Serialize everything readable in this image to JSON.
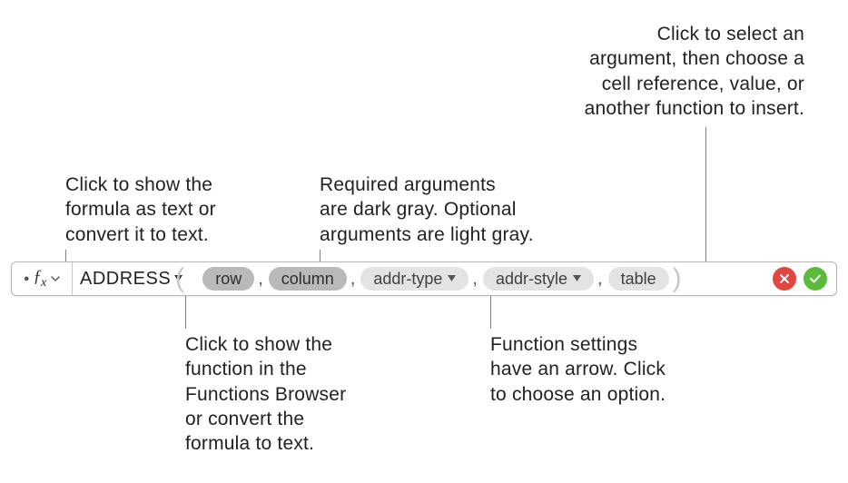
{
  "callouts": {
    "fx": "Click to show the\nformula as text or\nconvert it to text.",
    "required": "Required arguments\nare dark gray. Optional\narguments are light gray.",
    "selectArg": "Click to select an\nargument, then choose a\ncell reference, value, or\nanother function to insert.",
    "functionName": "Click to show the\nfunction in the\nFunctions Browser\nor convert the\nformula to text.",
    "settings": "Function settings\nhave an arrow. Click\nto choose an option."
  },
  "bar": {
    "fxLabel": "fx",
    "functionName": "ADDRESS",
    "args": [
      {
        "label": "row",
        "kind": "req",
        "arrow": false
      },
      {
        "label": "column",
        "kind": "req",
        "arrow": false
      },
      {
        "label": "addr-type",
        "kind": "opt",
        "arrow": true
      },
      {
        "label": "addr-style",
        "kind": "opt",
        "arrow": true
      },
      {
        "label": "table",
        "kind": "opt",
        "arrow": false
      }
    ]
  }
}
